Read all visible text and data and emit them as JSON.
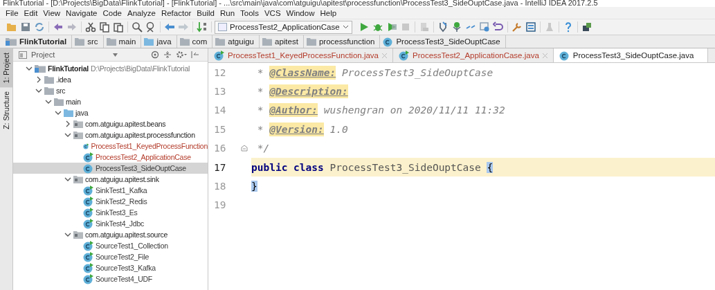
{
  "window": {
    "title": "FlinkTutorial - [D:\\Projects\\BigData\\FlinkTutorial] - [FlinkTutorial] - ...\\src\\main\\java\\com\\atguigu\\apitest\\processfunction\\ProcessTest3_SideOuptCase.java - IntelliJ IDEA 2017.2.5"
  },
  "menu": [
    "File",
    "Edit",
    "View",
    "Navigate",
    "Code",
    "Analyze",
    "Refactor",
    "Build",
    "Run",
    "Tools",
    "VCS",
    "Window",
    "Help"
  ],
  "run_config": "ProcessTest2_ApplicationCase",
  "breadcrumb": [
    {
      "label": "FlinkTutorial",
      "kind": "module"
    },
    {
      "label": "src",
      "kind": "folder"
    },
    {
      "label": "main",
      "kind": "folder"
    },
    {
      "label": "java",
      "kind": "source"
    },
    {
      "label": "com",
      "kind": "folder"
    },
    {
      "label": "atguigu",
      "kind": "folder"
    },
    {
      "label": "apitest",
      "kind": "folder"
    },
    {
      "label": "processfunction",
      "kind": "folder"
    },
    {
      "label": "ProcessTest3_SideOuptCase",
      "kind": "class"
    }
  ],
  "side_tabs": [
    {
      "label": "1: Project",
      "selected": true
    },
    {
      "label": "Z: Structure",
      "selected": false
    }
  ],
  "project_panel": {
    "title": "Project",
    "tree": [
      {
        "label": "FlinkTutorial",
        "path": "D:\\Projects\\BigData\\FlinkTutorial",
        "kind": "module",
        "expanded": true,
        "children": [
          {
            "label": ".idea",
            "kind": "folder",
            "expanded": false
          },
          {
            "label": "src",
            "kind": "folder",
            "expanded": true,
            "children": [
              {
                "label": "main",
                "kind": "folder",
                "expanded": true,
                "children": [
                  {
                    "label": "java",
                    "kind": "source",
                    "expanded": true,
                    "children": [
                      {
                        "label": "com.atguigu.apitest.beans",
                        "kind": "package",
                        "expanded": false
                      },
                      {
                        "label": "com.atguigu.apitest.processfunction",
                        "kind": "package",
                        "expanded": true,
                        "children": [
                          {
                            "label": "ProcessTest1_KeyedProcessFunction",
                            "kind": "class",
                            "runnable": true,
                            "color": "#b33b2a",
                            "selected": false
                          },
                          {
                            "label": "ProcessTest2_ApplicationCase",
                            "kind": "class",
                            "runnable": true,
                            "color": "#b33b2a",
                            "selected": false
                          },
                          {
                            "label": "ProcessTest3_SideOuptCase",
                            "kind": "class",
                            "runnable": false,
                            "color": "#3a3a3a",
                            "selected": true
                          }
                        ]
                      },
                      {
                        "label": "com.atguigu.apitest.sink",
                        "kind": "package",
                        "expanded": true,
                        "children": [
                          {
                            "label": "SinkTest1_Kafka",
                            "kind": "class",
                            "runnable": true,
                            "color": "#3a3a3a",
                            "selected": false
                          },
                          {
                            "label": "SinkTest2_Redis",
                            "kind": "class",
                            "runnable": true,
                            "color": "#3a3a3a",
                            "selected": false
                          },
                          {
                            "label": "SinkTest3_Es",
                            "kind": "class",
                            "runnable": true,
                            "color": "#3a3a3a",
                            "selected": false
                          },
                          {
                            "label": "SinkTest4_Jdbc",
                            "kind": "class",
                            "runnable": true,
                            "color": "#3a3a3a",
                            "selected": false
                          }
                        ]
                      },
                      {
                        "label": "com.atguigu.apitest.source",
                        "kind": "package",
                        "expanded": true,
                        "children": [
                          {
                            "label": "SourceTest1_Collection",
                            "kind": "class",
                            "runnable": true,
                            "color": "#3a3a3a",
                            "selected": false
                          },
                          {
                            "label": "SourceTest2_File",
                            "kind": "class",
                            "runnable": true,
                            "color": "#3a3a3a",
                            "selected": false
                          },
                          {
                            "label": "SourceTest3_Kafka",
                            "kind": "class",
                            "runnable": true,
                            "color": "#3a3a3a",
                            "selected": false
                          },
                          {
                            "label": "SourceTest4_UDF",
                            "kind": "class",
                            "runnable": true,
                            "color": "#3a3a3a",
                            "selected": false
                          }
                        ]
                      }
                    ]
                  }
                ]
              }
            ]
          }
        ]
      }
    ]
  },
  "editor_tabs": [
    {
      "label": "ProcessTest1_KeyedProcessFunction.java",
      "runnable": true,
      "color": "#b33b2a",
      "selected": false
    },
    {
      "label": "ProcessTest2_ApplicationCase.java",
      "runnable": true,
      "color": "#b33b2a",
      "selected": false
    },
    {
      "label": "ProcessTest3_SideOuptCase.java",
      "runnable": false,
      "color": "#222222",
      "selected": true
    }
  ],
  "code_lines": [
    {
      "number": "12",
      "current": false,
      "fold": false,
      "tokens": [
        {
          "text": " * ",
          "kind": "comment"
        },
        {
          "text": "@ClassName:",
          "kind": "tag"
        },
        {
          "text": " ProcessTest3_SideOuptCase",
          "kind": "comment"
        }
      ]
    },
    {
      "number": "13",
      "current": false,
      "fold": false,
      "tokens": [
        {
          "text": " * ",
          "kind": "comment"
        },
        {
          "text": "@Description:",
          "kind": "tag"
        }
      ]
    },
    {
      "number": "14",
      "current": false,
      "fold": false,
      "tokens": [
        {
          "text": " * ",
          "kind": "comment"
        },
        {
          "text": "@Author:",
          "kind": "tag"
        },
        {
          "text": " wushengran on 2020/11/11 11:32",
          "kind": "comment"
        }
      ]
    },
    {
      "number": "15",
      "current": false,
      "fold": false,
      "tokens": [
        {
          "text": " * ",
          "kind": "comment"
        },
        {
          "text": "@Version:",
          "kind": "tag"
        },
        {
          "text": " 1.0",
          "kind": "comment"
        }
      ]
    },
    {
      "number": "16",
      "current": false,
      "fold": true,
      "tokens": [
        {
          "text": " */",
          "kind": "comment"
        }
      ]
    },
    {
      "number": "17",
      "current": true,
      "fold": false,
      "tokens": [
        {
          "text": "public class",
          "kind": "keyword"
        },
        {
          "text": " ProcessTest3_SideOuptCase ",
          "kind": "plain"
        },
        {
          "text": "{",
          "kind": "brace"
        }
      ]
    },
    {
      "number": "18",
      "current": false,
      "fold": false,
      "tokens": [
        {
          "text": "}",
          "kind": "brace"
        }
      ]
    },
    {
      "number": "19",
      "current": false,
      "fold": false
    }
  ]
}
